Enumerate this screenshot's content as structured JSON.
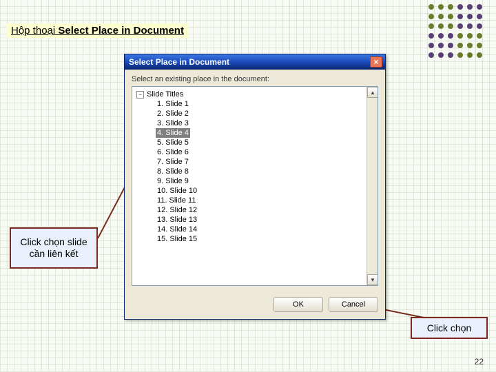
{
  "heading": {
    "prefix": "Hộp thoại ",
    "bold": "Select Place in Document"
  },
  "dialog": {
    "title": "Select Place in Document",
    "prompt": "Select an existing place in the document:",
    "root_label": "Slide Titles",
    "expander_glyph": "−",
    "selected_index": 3,
    "slides": [
      "1. Slide 1",
      "2. Slide 2",
      "3. Slide 3",
      "4. Slide 4",
      "5. Slide 5",
      "6. Slide 6",
      "7. Slide 7",
      "8. Slide 8",
      "9. Slide 9",
      "10. Slide 10",
      "11. Slide 11",
      "12. Slide 12",
      "13. Slide 13",
      "14. Slide 14",
      "15. Slide 15"
    ],
    "ok_label": "OK",
    "cancel_label": "Cancel",
    "close_glyph": "×",
    "scroll_up": "▲",
    "scroll_down": "▼"
  },
  "callouts": {
    "left": "Click chọn slide cần liên kết",
    "bottom": "Click chọn"
  },
  "page_number": "22"
}
